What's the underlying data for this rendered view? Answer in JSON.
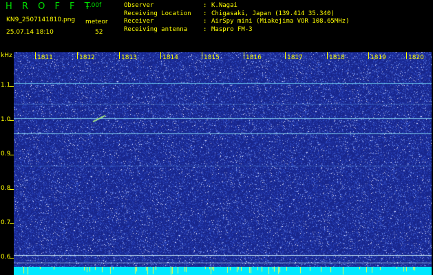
{
  "header": {
    "title": "H R O F F T",
    "version": "1.00f",
    "filename": "KN9_2507141810.png",
    "meteor_label": "meteor",
    "datetime": "25.07.14 18:10",
    "meteor_count": "52"
  },
  "info": [
    {
      "key": "Observer",
      "value": "K.Nagai"
    },
    {
      "key": "Receiving Location",
      "value": "Chigasaki, Japan (139.414 35.340)"
    },
    {
      "key": "Receiver",
      "value": "AirSpy mini (Miakejima VOR 108.65MHz)"
    },
    {
      "key": "Receiving antenna",
      "value": "Maspro FM-3"
    }
  ],
  "axes": {
    "y_unit": "kHz",
    "y_ticks": [
      "1.1",
      "1.0",
      "0.9",
      "0.8",
      "0.7",
      "0.6"
    ],
    "x_ticks": [
      "1811",
      "1812",
      "1813",
      "1814",
      "1815",
      "1816",
      "1817",
      "1818",
      "1819",
      "1820"
    ]
  },
  "colors": {
    "background": "#1a2a8e",
    "labels": "#ffff00",
    "title": "#00e000",
    "bottom_bar": "#00e8ff"
  }
}
